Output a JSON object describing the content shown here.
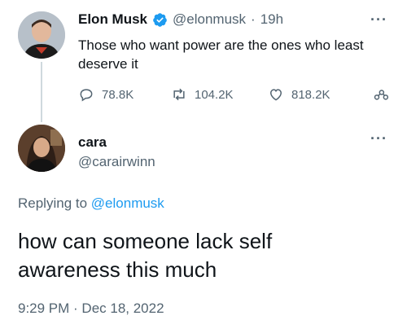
{
  "parent_tweet": {
    "display_name": "Elon Musk",
    "handle": "@elonmusk",
    "separator": "·",
    "time_ago": "19h",
    "text": "Those who want power are the ones who least deserve it",
    "stats": {
      "replies": "78.8K",
      "retweets": "104.2K",
      "likes": "818.2K"
    },
    "more_label": "···"
  },
  "reply_tweet": {
    "display_name": "cara",
    "handle": "@carairwinn",
    "more_label": "···",
    "replying_prefix": "Replying to",
    "replying_handle": "@elonmusk",
    "text": "how can someone lack self awareness this much",
    "timestamp": "9:29 PM · Dec 18, 2022"
  },
  "colors": {
    "verified_badge": "#1d9bf0",
    "link": "#1d9bf0",
    "muted_text": "#536471",
    "thread_line": "#cfd9de"
  },
  "icons": {
    "verified": "verified-badge-icon",
    "reply": "reply-icon",
    "retweet": "retweet-icon",
    "like": "heart-icon",
    "share": "share-icon",
    "more": "more-icon"
  }
}
